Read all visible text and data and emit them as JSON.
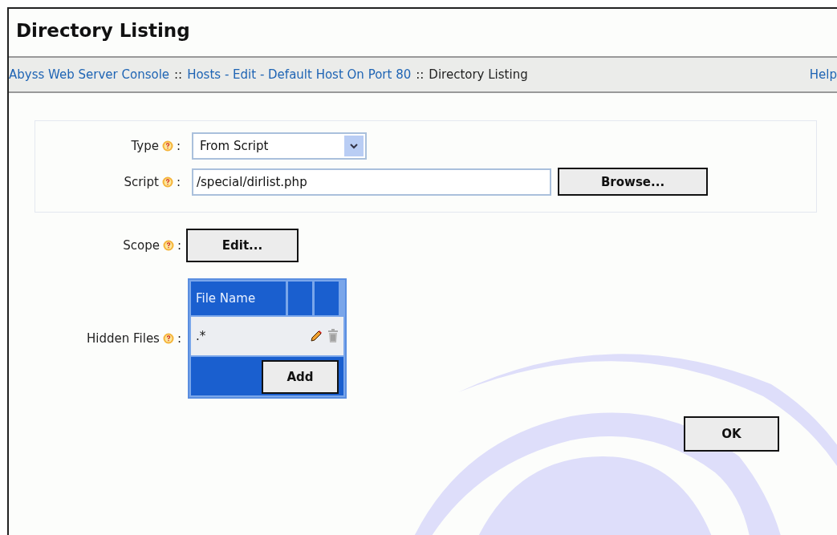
{
  "window": {
    "title": "Directory Listing"
  },
  "breadcrumb": {
    "links": [
      "Abyss Web Server Console",
      "Hosts - Edit - Default Host On Port 80"
    ],
    "separator": "::",
    "current": "Directory Listing",
    "help": "Help"
  },
  "form": {
    "type": {
      "label": "Type",
      "colon": ":",
      "value": "From Script"
    },
    "script": {
      "label": "Script",
      "colon": ":",
      "value": "/special/dirlist.php",
      "button": "Browse..."
    },
    "scope": {
      "label": "Scope",
      "colon": ":",
      "button": "Edit..."
    },
    "hidden_files": {
      "label": "Hidden Files",
      "colon": ":",
      "columns": [
        "File Name"
      ],
      "rows": [
        {
          "file_name": ".*"
        }
      ],
      "add_button": "Add"
    }
  },
  "buttons": [
    "OK"
  ]
}
